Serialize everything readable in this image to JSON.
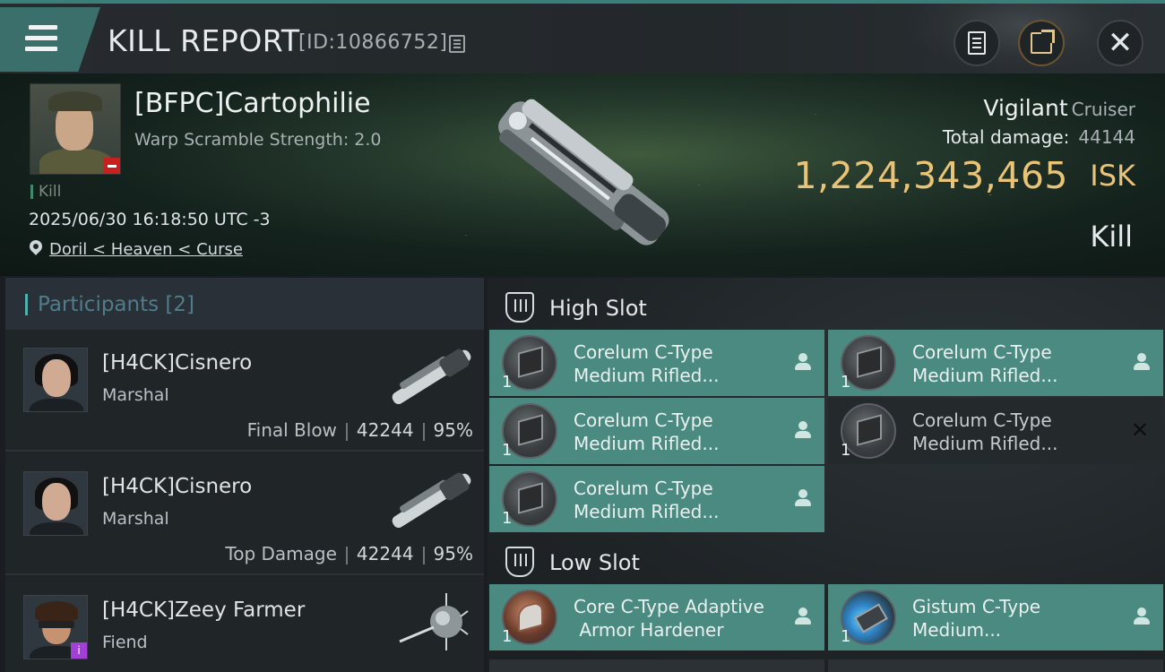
{
  "header": {
    "title": "KILL REPORT",
    "report_id": "[ID:10866752]"
  },
  "victim": {
    "name": "[BFPC]Cartophilie",
    "scramble": "Warp Scramble Strength: 2.0",
    "result_tag": "Kill",
    "datetime": "2025/06/30 16:18:50 UTC -3",
    "location": "Doril < Heaven < Curse",
    "ship": "Vigilant",
    "ship_class": "Cruiser",
    "total_damage_label": "Total damage:",
    "total_damage": "44144",
    "isk_value": "1,224,343,465",
    "isk_unit": "ISK",
    "result": "Kill"
  },
  "participants": {
    "title": "Participants [2]",
    "rows": [
      {
        "name": "[H4CK]Cisnero",
        "ship": "Marshal",
        "label": "Final Blow",
        "damage": "42244",
        "percent": "95%"
      },
      {
        "name": "[H4CK]Cisnero",
        "ship": "Marshal",
        "label": "Top Damage",
        "damage": "42244",
        "percent": "95%"
      },
      {
        "name": "[H4CK]Zeey Farmer",
        "ship": "Fiend",
        "label": "",
        "damage": "",
        "percent": ""
      }
    ]
  },
  "fitting": {
    "high_slot_label": "High Slot",
    "low_slot_label": "Low Slot",
    "high": [
      {
        "line1": "Corelum C-Type",
        "line2": "Medium Rifled...",
        "qty": "1",
        "state": "dropped"
      },
      {
        "line1": "Corelum C-Type",
        "line2": "Medium Rifled...",
        "qty": "1",
        "state": "dropped"
      },
      {
        "line1": "Corelum C-Type",
        "line2": "Medium Rifled...",
        "qty": "1",
        "state": "dropped"
      },
      {
        "line1": "Corelum C-Type",
        "line2": "Medium Rifled...",
        "qty": "1",
        "state": "destroyed"
      },
      {
        "line1": "Corelum C-Type",
        "line2": "Medium Rifled...",
        "qty": "1",
        "state": "dropped"
      }
    ],
    "low": [
      {
        "line1": "Core C-Type Adaptive",
        "line2": " Armor Hardener",
        "qty": "1",
        "state": "dropped"
      },
      {
        "line1": "Gistum C-Type",
        "line2": "Medium...",
        "qty": "1",
        "state": "dropped"
      }
    ]
  },
  "colors": {
    "accent_teal": "#4a8a80",
    "isk_gold": "#e9c377",
    "header_teal": "#3b6f6c"
  }
}
